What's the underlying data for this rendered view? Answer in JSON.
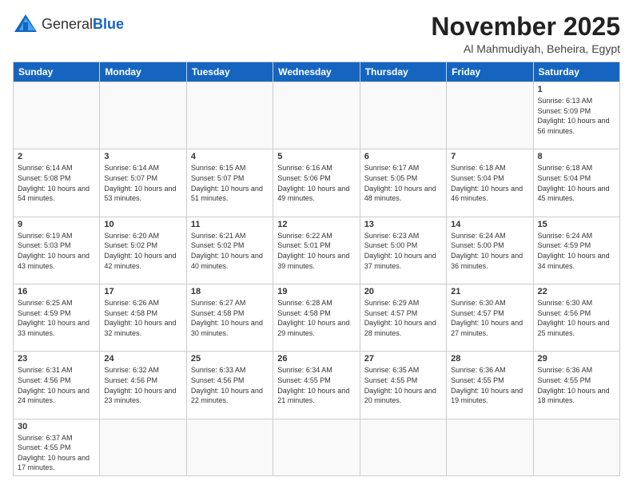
{
  "logo": {
    "text_general": "General",
    "text_blue": "Blue"
  },
  "title": "November 2025",
  "subtitle": "Al Mahmudiyah, Beheira, Egypt",
  "days_of_week": [
    "Sunday",
    "Monday",
    "Tuesday",
    "Wednesday",
    "Thursday",
    "Friday",
    "Saturday"
  ],
  "weeks": [
    [
      {
        "day": "",
        "info": ""
      },
      {
        "day": "",
        "info": ""
      },
      {
        "day": "",
        "info": ""
      },
      {
        "day": "",
        "info": ""
      },
      {
        "day": "",
        "info": ""
      },
      {
        "day": "",
        "info": ""
      },
      {
        "day": "1",
        "info": "Sunrise: 6:13 AM\nSunset: 5:09 PM\nDaylight: 10 hours and 56 minutes."
      }
    ],
    [
      {
        "day": "2",
        "info": "Sunrise: 6:14 AM\nSunset: 5:08 PM\nDaylight: 10 hours and 54 minutes."
      },
      {
        "day": "3",
        "info": "Sunrise: 6:14 AM\nSunset: 5:07 PM\nDaylight: 10 hours and 53 minutes."
      },
      {
        "day": "4",
        "info": "Sunrise: 6:15 AM\nSunset: 5:07 PM\nDaylight: 10 hours and 51 minutes."
      },
      {
        "day": "5",
        "info": "Sunrise: 6:16 AM\nSunset: 5:06 PM\nDaylight: 10 hours and 49 minutes."
      },
      {
        "day": "6",
        "info": "Sunrise: 6:17 AM\nSunset: 5:05 PM\nDaylight: 10 hours and 48 minutes."
      },
      {
        "day": "7",
        "info": "Sunrise: 6:18 AM\nSunset: 5:04 PM\nDaylight: 10 hours and 46 minutes."
      },
      {
        "day": "8",
        "info": "Sunrise: 6:18 AM\nSunset: 5:04 PM\nDaylight: 10 hours and 45 minutes."
      }
    ],
    [
      {
        "day": "9",
        "info": "Sunrise: 6:19 AM\nSunset: 5:03 PM\nDaylight: 10 hours and 43 minutes."
      },
      {
        "day": "10",
        "info": "Sunrise: 6:20 AM\nSunset: 5:02 PM\nDaylight: 10 hours and 42 minutes."
      },
      {
        "day": "11",
        "info": "Sunrise: 6:21 AM\nSunset: 5:02 PM\nDaylight: 10 hours and 40 minutes."
      },
      {
        "day": "12",
        "info": "Sunrise: 6:22 AM\nSunset: 5:01 PM\nDaylight: 10 hours and 39 minutes."
      },
      {
        "day": "13",
        "info": "Sunrise: 6:23 AM\nSunset: 5:00 PM\nDaylight: 10 hours and 37 minutes."
      },
      {
        "day": "14",
        "info": "Sunrise: 6:24 AM\nSunset: 5:00 PM\nDaylight: 10 hours and 36 minutes."
      },
      {
        "day": "15",
        "info": "Sunrise: 6:24 AM\nSunset: 4:59 PM\nDaylight: 10 hours and 34 minutes."
      }
    ],
    [
      {
        "day": "16",
        "info": "Sunrise: 6:25 AM\nSunset: 4:59 PM\nDaylight: 10 hours and 33 minutes."
      },
      {
        "day": "17",
        "info": "Sunrise: 6:26 AM\nSunset: 4:58 PM\nDaylight: 10 hours and 32 minutes."
      },
      {
        "day": "18",
        "info": "Sunrise: 6:27 AM\nSunset: 4:58 PM\nDaylight: 10 hours and 30 minutes."
      },
      {
        "day": "19",
        "info": "Sunrise: 6:28 AM\nSunset: 4:58 PM\nDaylight: 10 hours and 29 minutes."
      },
      {
        "day": "20",
        "info": "Sunrise: 6:29 AM\nSunset: 4:57 PM\nDaylight: 10 hours and 28 minutes."
      },
      {
        "day": "21",
        "info": "Sunrise: 6:30 AM\nSunset: 4:57 PM\nDaylight: 10 hours and 27 minutes."
      },
      {
        "day": "22",
        "info": "Sunrise: 6:30 AM\nSunset: 4:56 PM\nDaylight: 10 hours and 25 minutes."
      }
    ],
    [
      {
        "day": "23",
        "info": "Sunrise: 6:31 AM\nSunset: 4:56 PM\nDaylight: 10 hours and 24 minutes."
      },
      {
        "day": "24",
        "info": "Sunrise: 6:32 AM\nSunset: 4:56 PM\nDaylight: 10 hours and 23 minutes."
      },
      {
        "day": "25",
        "info": "Sunrise: 6:33 AM\nSunset: 4:56 PM\nDaylight: 10 hours and 22 minutes."
      },
      {
        "day": "26",
        "info": "Sunrise: 6:34 AM\nSunset: 4:55 PM\nDaylight: 10 hours and 21 minutes."
      },
      {
        "day": "27",
        "info": "Sunrise: 6:35 AM\nSunset: 4:55 PM\nDaylight: 10 hours and 20 minutes."
      },
      {
        "day": "28",
        "info": "Sunrise: 6:36 AM\nSunset: 4:55 PM\nDaylight: 10 hours and 19 minutes."
      },
      {
        "day": "29",
        "info": "Sunrise: 6:36 AM\nSunset: 4:55 PM\nDaylight: 10 hours and 18 minutes."
      }
    ],
    [
      {
        "day": "30",
        "info": "Sunrise: 6:37 AM\nSunset: 4:55 PM\nDaylight: 10 hours and 17 minutes."
      },
      {
        "day": "",
        "info": ""
      },
      {
        "day": "",
        "info": ""
      },
      {
        "day": "",
        "info": ""
      },
      {
        "day": "",
        "info": ""
      },
      {
        "day": "",
        "info": ""
      },
      {
        "day": "",
        "info": ""
      }
    ]
  ]
}
